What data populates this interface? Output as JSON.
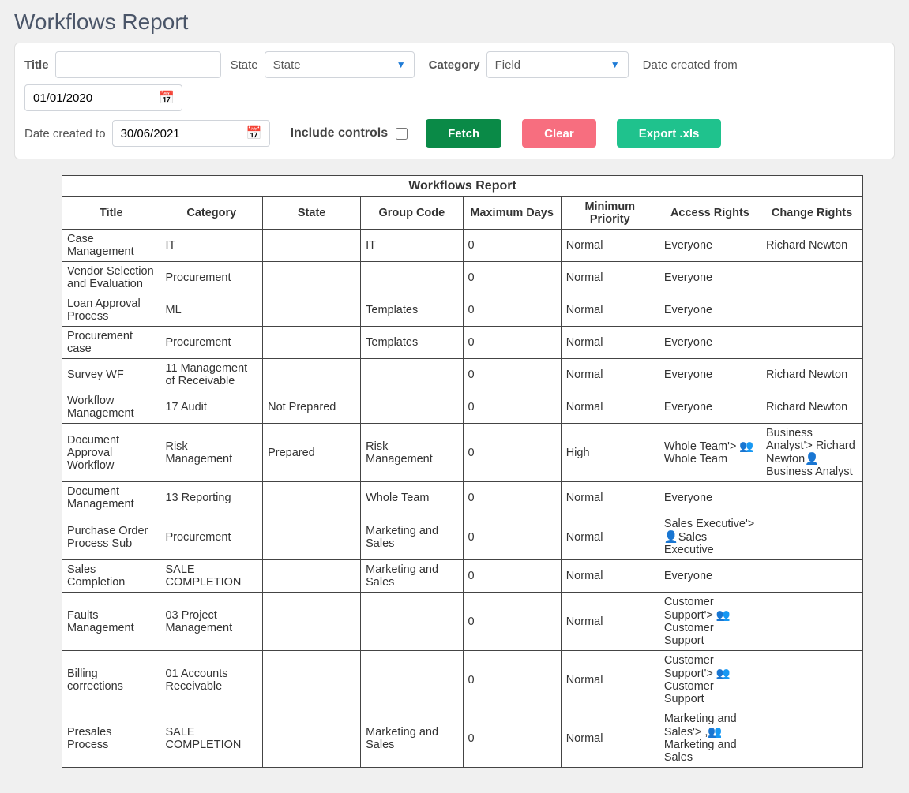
{
  "page_title": "Workflows Report",
  "filters": {
    "title_label": "Title",
    "title_value": "",
    "state_label": "State",
    "state_selected": "State",
    "category_label": "Category",
    "category_selected": "Field",
    "date_from_label": "Date created from",
    "date_from_value": "01/01/2020",
    "date_to_label": "Date created to",
    "date_to_value": "30/06/2021",
    "include_controls_label": "Include controls",
    "include_controls_checked": false
  },
  "buttons": {
    "fetch": "Fetch",
    "clear": "Clear",
    "export": "Export .xls"
  },
  "table": {
    "caption": "Workflows Report",
    "columns": [
      "Title",
      "Category",
      "State",
      "Group Code",
      "Maximum Days",
      "Minimum Priority",
      "Access Rights",
      "Change Rights"
    ],
    "rows": [
      {
        "title": "Case Management",
        "category": "IT",
        "state": "",
        "group": "IT",
        "max": "0",
        "min": "Normal",
        "access": "Everyone",
        "change": "Richard Newton"
      },
      {
        "title": "Vendor Selection and Evaluation",
        "category": "Procurement",
        "state": "",
        "group": "",
        "max": "0",
        "min": "Normal",
        "access": "Everyone",
        "change": ""
      },
      {
        "title": "Loan Approval Process",
        "category": "ML",
        "state": "",
        "group": "Templates",
        "max": "0",
        "min": "Normal",
        "access": "Everyone",
        "change": ""
      },
      {
        "title": "Procurement case",
        "category": "Procurement",
        "state": "",
        "group": "Templates",
        "max": "0",
        "min": "Normal",
        "access": "Everyone",
        "change": ""
      },
      {
        "title": "Survey WF",
        "category": "11 Management of Receivable",
        "state": "",
        "group": "",
        "max": "0",
        "min": "Normal",
        "access": "Everyone",
        "change": "Richard Newton"
      },
      {
        "title": "Workflow Management",
        "category": "17 Audit",
        "state": "Not Prepared",
        "group": "",
        "max": "0",
        "min": "Normal",
        "access": "Everyone",
        "change": "Richard Newton"
      },
      {
        "title": "Document Approval Workflow",
        "category": "Risk Management",
        "state": "Prepared",
        "group": "Risk Management",
        "max": "0",
        "min": "High",
        "access": "Whole Team'> 👥 Whole Team",
        "change": "Business Analyst'> Richard Newton👤 Business Analyst"
      },
      {
        "title": "Document Management",
        "category": "13 Reporting",
        "state": "",
        "group": "Whole Team",
        "max": "0",
        "min": "Normal",
        "access": "Everyone",
        "change": ""
      },
      {
        "title": "Purchase Order Process Sub",
        "category": "Procurement",
        "state": "",
        "group": "Marketing and Sales",
        "max": "0",
        "min": "Normal",
        "access": "Sales Executive'> 👤Sales Executive",
        "change": ""
      },
      {
        "title": "Sales Completion",
        "category": "SALE COMPLETION",
        "state": "",
        "group": "Marketing and Sales",
        "max": "0",
        "min": "Normal",
        "access": "Everyone",
        "change": ""
      },
      {
        "title": "Faults Management",
        "category": "03 Project Management",
        "state": "",
        "group": "",
        "max": "0",
        "min": "Normal",
        "access": "Customer Support'> 👥 Customer Support",
        "change": ""
      },
      {
        "title": "Billing corrections",
        "category": "01 Accounts Receivable",
        "state": "",
        "group": "",
        "max": "0",
        "min": "Normal",
        "access": "Customer Support'> 👥 Customer Support",
        "change": ""
      },
      {
        "title": "Presales Process",
        "category": "SALE COMPLETION",
        "state": "",
        "group": "Marketing and Sales",
        "max": "0",
        "min": "Normal",
        "access": "Marketing and Sales'> ,👥 Marketing and Sales",
        "change": ""
      }
    ]
  }
}
